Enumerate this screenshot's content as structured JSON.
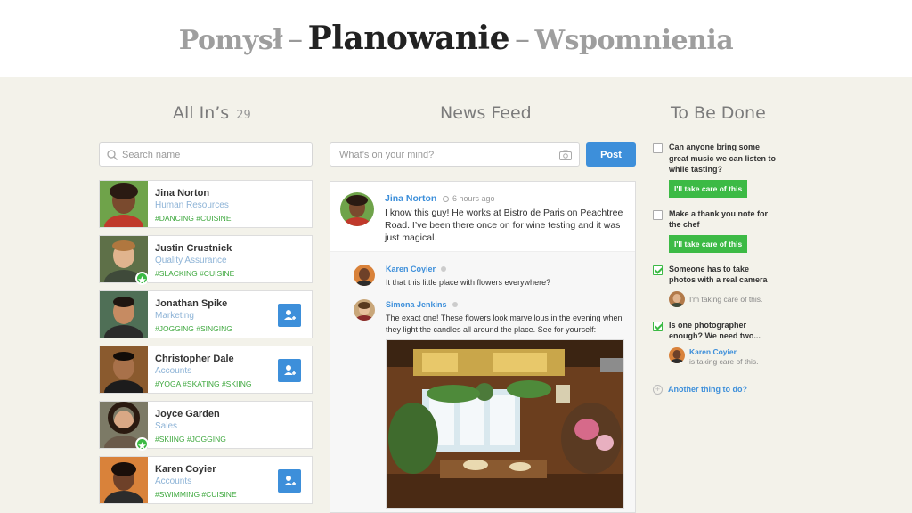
{
  "header": {
    "step1": "Pomysł",
    "step2": "Planowanie",
    "step3": "Wspomnienia",
    "sep": "–"
  },
  "columns": {
    "left_title": "All In’s",
    "left_count": "29",
    "middle_title": "News Feed",
    "right_title": "To Be Done"
  },
  "search": {
    "placeholder": "Search name"
  },
  "people": [
    {
      "name": "Jina Norton",
      "role": "Human Resources",
      "tags": "#DANCING #CUISINE"
    },
    {
      "name": "Justin Crustnick",
      "role": "Quality Assurance",
      "tags": "#SLACKING #CUISINE"
    },
    {
      "name": "Jonathan Spike",
      "role": "Marketing",
      "tags": "#JOGGING #SINGING"
    },
    {
      "name": "Christopher Dale",
      "role": "Accounts",
      "tags": "#YOGA #SKATING #SKIING"
    },
    {
      "name": "Joyce Garden",
      "role": "Sales",
      "tags": "#SKIING #JOGGING"
    },
    {
      "name": "Karen Coyier",
      "role": "Accounts",
      "tags": "#SWIMMING #CUISINE"
    }
  ],
  "composer": {
    "placeholder": "What’s on your mind?",
    "post_label": "Post"
  },
  "post": {
    "author": "Jina Norton",
    "time": "6 hours ago",
    "text": "I know this guy! He works at Bistro de Paris on Peachtree Road. I’ve been there once on for wine testing and it was just magical."
  },
  "comments": [
    {
      "author": "Karen Coyier",
      "text": "It that this little place with flowers everywhere?"
    },
    {
      "author": "Simona Jenkins",
      "text": "The exact one! These flowers look marvellous in the evening when they light the candles all around the place. See for yourself:"
    }
  ],
  "todos": [
    {
      "text": "Can anyone bring some great music we can listen to while tasting?",
      "action": "I'll take care of this"
    },
    {
      "text": "Make a thank you note for the chef",
      "action": "I'll take care of this"
    },
    {
      "text": "Someone has to take photos with a real camera",
      "taker_note": "I'm taking care of this."
    },
    {
      "text": "Is one photographer enough? We need two...",
      "taker_name": "Karen Coyier",
      "taker_note": "is taking care of this."
    }
  ],
  "another": "Another thing to do?",
  "colors": {
    "accent_blue": "#3d8fda",
    "accent_green": "#3cba45",
    "background": "#f3f2ea"
  }
}
